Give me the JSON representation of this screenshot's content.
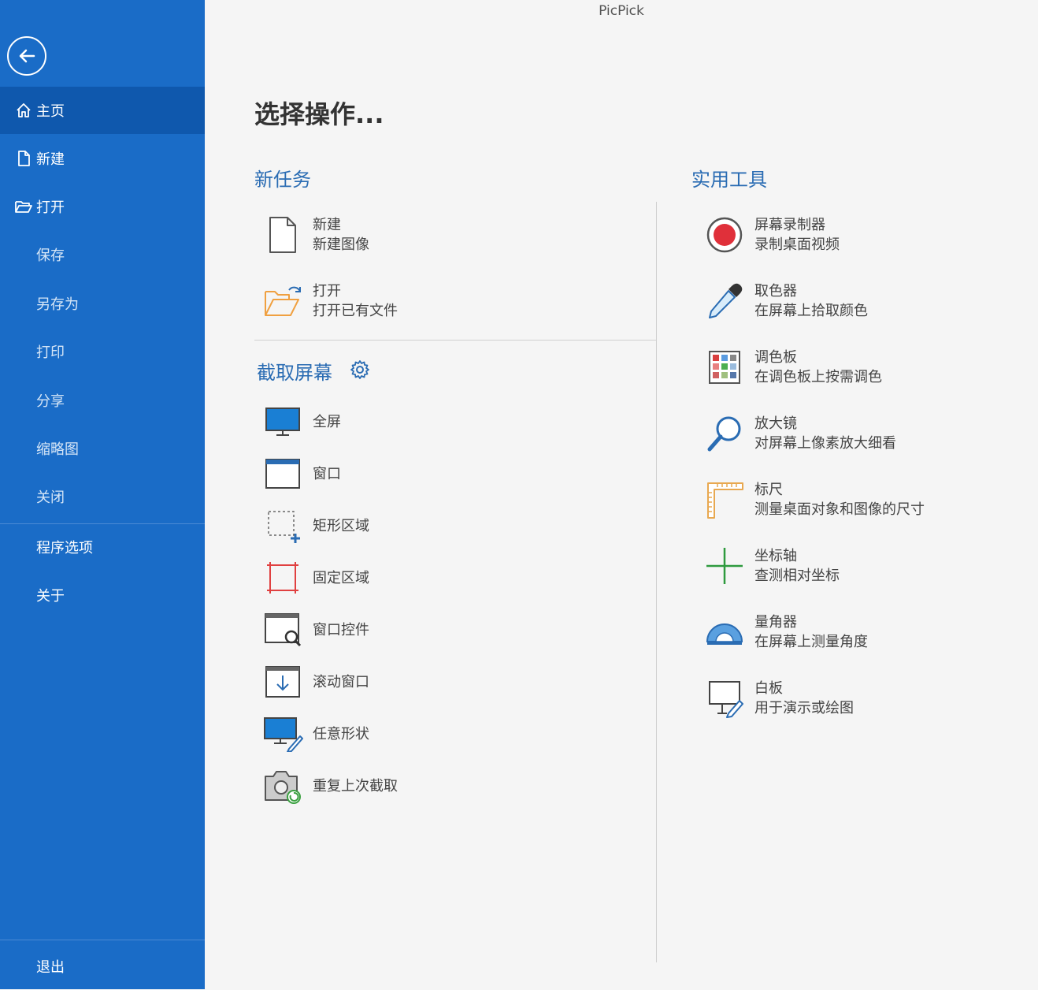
{
  "app": {
    "title": "PicPick"
  },
  "sidebar": {
    "items": [
      {
        "label": "主页",
        "icon": "home-icon"
      },
      {
        "label": "新建",
        "icon": "new-file-icon"
      },
      {
        "label": "打开",
        "icon": "open-folder-icon"
      },
      {
        "label": "保存"
      },
      {
        "label": "另存为"
      },
      {
        "label": "打印"
      },
      {
        "label": "分享"
      },
      {
        "label": "缩略图"
      },
      {
        "label": "关闭"
      },
      {
        "label": "程序选项"
      },
      {
        "label": "关于"
      },
      {
        "label": "退出"
      }
    ],
    "active_label": "主页"
  },
  "main": {
    "heading": "选择操作...",
    "new_task": {
      "title": "新任务",
      "items": [
        {
          "label": "新建",
          "desc": "新建图像",
          "icon": "new-file-icon"
        },
        {
          "label": "打开",
          "desc": "打开已有文件",
          "icon": "open-folder-icon"
        }
      ]
    },
    "capture": {
      "title": "截取屏幕",
      "settings_icon": "gear-icon",
      "items": [
        {
          "label": "全屏",
          "icon": "monitor-icon"
        },
        {
          "label": "窗口",
          "icon": "window-icon"
        },
        {
          "label": "矩形区域",
          "icon": "rect-region-icon"
        },
        {
          "label": "固定区域",
          "icon": "fixed-region-icon"
        },
        {
          "label": "窗口控件",
          "icon": "window-control-icon"
        },
        {
          "label": "滚动窗口",
          "icon": "scroll-window-icon"
        },
        {
          "label": "任意形状",
          "icon": "freehand-icon"
        },
        {
          "label": "重复上次截取",
          "icon": "repeat-capture-icon"
        }
      ]
    },
    "utilities": {
      "title": "实用工具",
      "items": [
        {
          "label": "屏幕录制器",
          "desc": "录制桌面视频",
          "icon": "record-icon"
        },
        {
          "label": "取色器",
          "desc": "在屏幕上拾取颜色",
          "icon": "eyedropper-icon"
        },
        {
          "label": "调色板",
          "desc": "在调色板上按需调色",
          "icon": "palette-icon"
        },
        {
          "label": "放大镜",
          "desc": "对屏幕上像素放大细看",
          "icon": "magnifier-icon"
        },
        {
          "label": "标尺",
          "desc": "测量桌面对象和图像的尺寸",
          "icon": "ruler-icon"
        },
        {
          "label": "坐标轴",
          "desc": "查测相对坐标",
          "icon": "crosshair-icon"
        },
        {
          "label": "量角器",
          "desc": "在屏幕上测量角度",
          "icon": "protractor-icon"
        },
        {
          "label": "白板",
          "desc": "用于演示或绘图",
          "icon": "whiteboard-icon"
        }
      ]
    }
  },
  "colors": {
    "sidebar": "#1a6cc7",
    "sidebar_active": "#0f58ad",
    "accent": "#2a6cb3",
    "background": "#f5f5f5"
  }
}
